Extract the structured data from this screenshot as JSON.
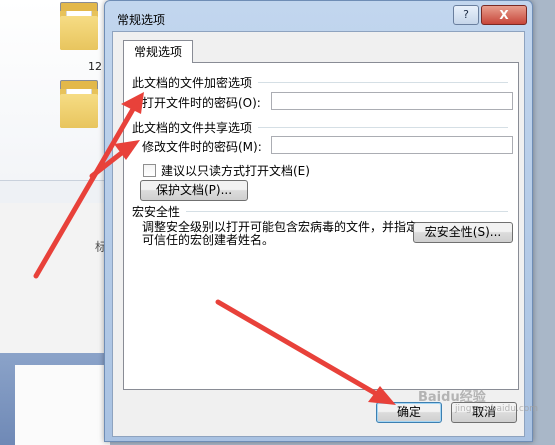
{
  "background": {
    "folder_label": "12",
    "side_char": "标"
  },
  "dialog": {
    "title": "常规选项",
    "help_label": "?",
    "close_label": "X",
    "tab_label": "常规选项",
    "encrypt_section": "此文档的文件加密选项",
    "open_password_label": "打开文件时的密码(O):",
    "open_password_value": "",
    "share_section": "此文档的文件共享选项",
    "modify_password_label": "修改文件时的密码(M):",
    "modify_password_value": "",
    "readonly_label": "建议以只读方式打开文档(E)",
    "protect_button": "保护文档(P)...",
    "macro_section": "宏安全性",
    "macro_desc": "调整安全级别以打开可能包含宏病毒的文件，并指定可信任的宏创建者姓名。",
    "macro_button": "宏安全性(S)...",
    "ok_button": "确定",
    "cancel_button": "取消"
  },
  "watermark": {
    "text": "Baidu经验",
    "sub": "jingyan.baidu.com"
  },
  "colors": {
    "arrow": "#e8413a",
    "title_bar": "#b8cde8",
    "close_button": "#c7463a"
  }
}
